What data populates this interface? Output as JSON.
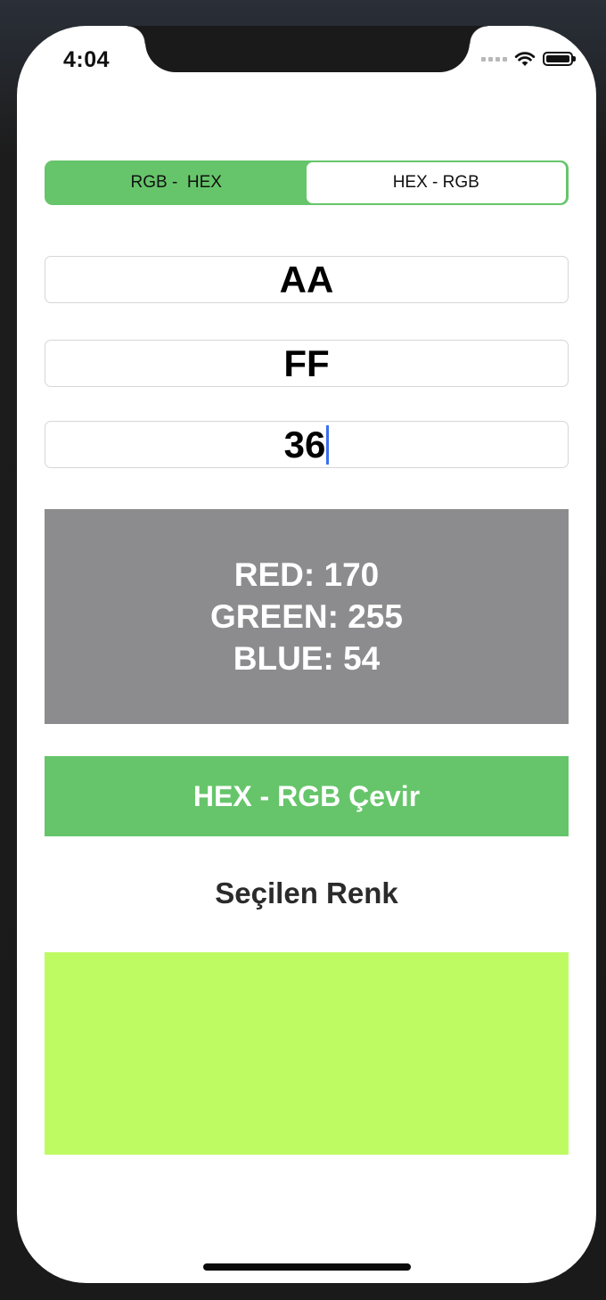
{
  "status_bar": {
    "time": "4:04",
    "wifi_icon": "wifi-icon",
    "battery_icon": "battery-icon"
  },
  "segmented_control": {
    "segments": [
      "RGB -  HEX",
      "HEX - RGB"
    ],
    "selected_index": 1
  },
  "inputs": {
    "red_hex": "AA",
    "green_hex": "FF",
    "blue_hex": "36"
  },
  "result": {
    "red_line": "RED: 170",
    "green_line": "GREEN: 255",
    "blue_line": "BLUE: 54"
  },
  "convert_button": {
    "label": "HEX - RGB Çevir"
  },
  "selected_color": {
    "label": "Seçilen Renk",
    "hex_color": "#BEFB62"
  },
  "colors": {
    "accent_green": "#66C56A",
    "result_background": "#8C8C8E",
    "caret_blue": "#3A6FF0"
  }
}
